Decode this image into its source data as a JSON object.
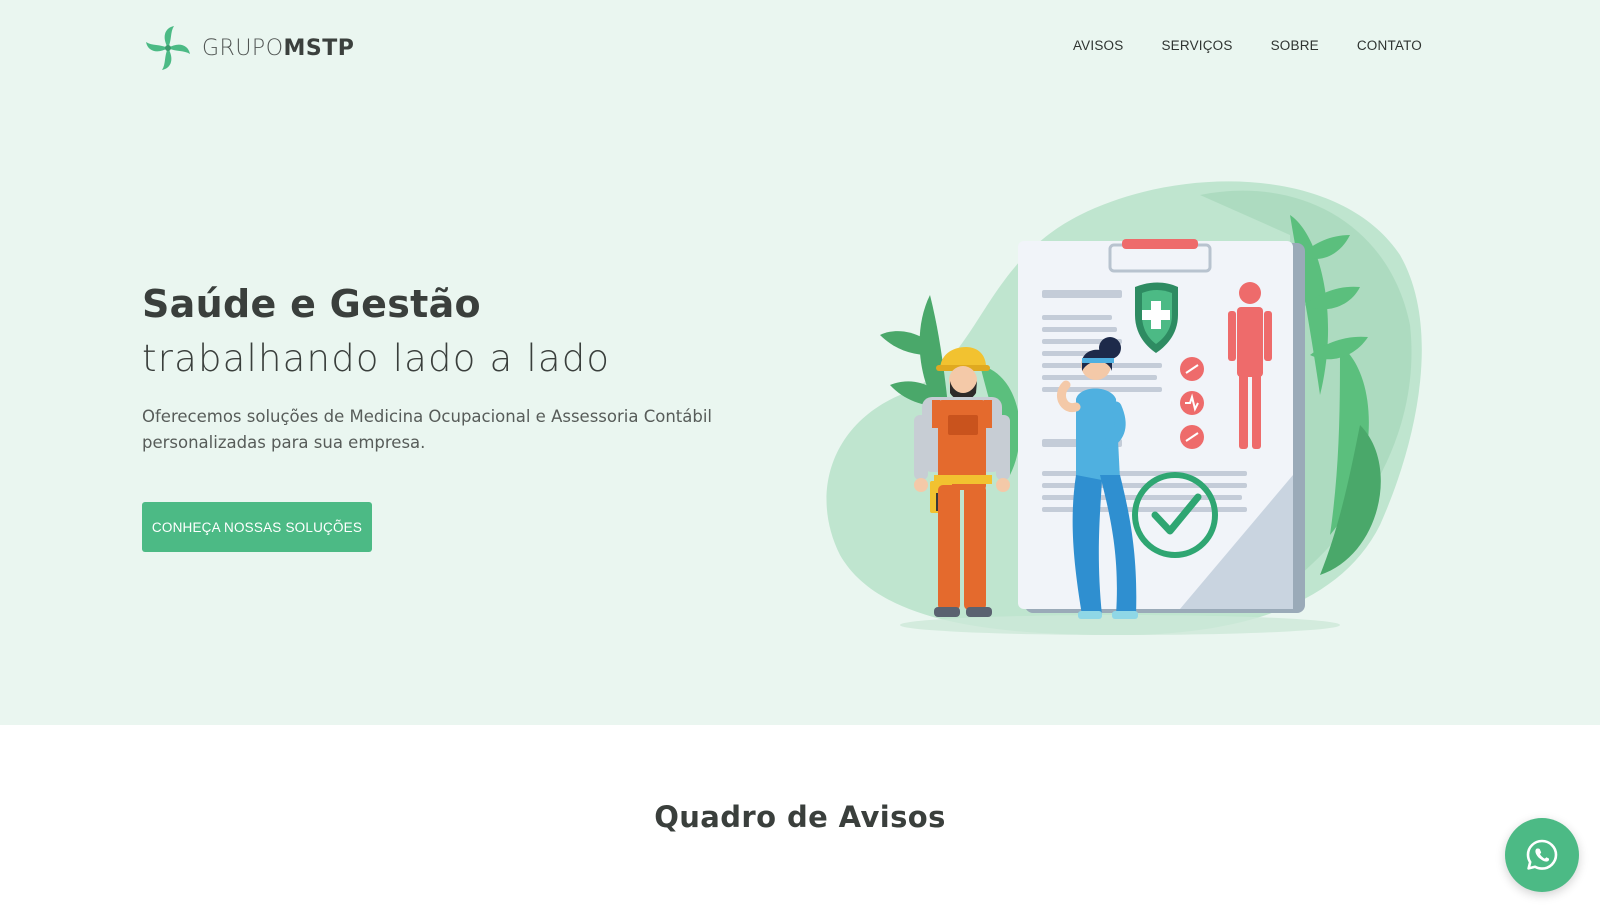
{
  "brand": {
    "name_light": "GRUPO",
    "name_bold": "MSTP",
    "color": "#4cba85"
  },
  "nav": {
    "items": [
      {
        "label": "AVISOS"
      },
      {
        "label": "SERVIÇOS"
      },
      {
        "label": "SOBRE"
      },
      {
        "label": "CONTATO"
      }
    ]
  },
  "hero": {
    "title": "Saúde e Gestão",
    "subtitle": "trabalhando lado a lado",
    "description_line1": "Oferecemos soluções de Medicina Ocupacional e Assessoria Contábil",
    "description_line2": "personalizadas para sua empresa.",
    "cta_label": "CONHEÇA NOSSAS SOLUÇÕES",
    "background": "#eaf6f0",
    "illustration_icon": "medical-clipboard-illustration"
  },
  "section": {
    "title": "Quadro de Avisos"
  },
  "floating": {
    "icon": "whatsapp-icon"
  }
}
